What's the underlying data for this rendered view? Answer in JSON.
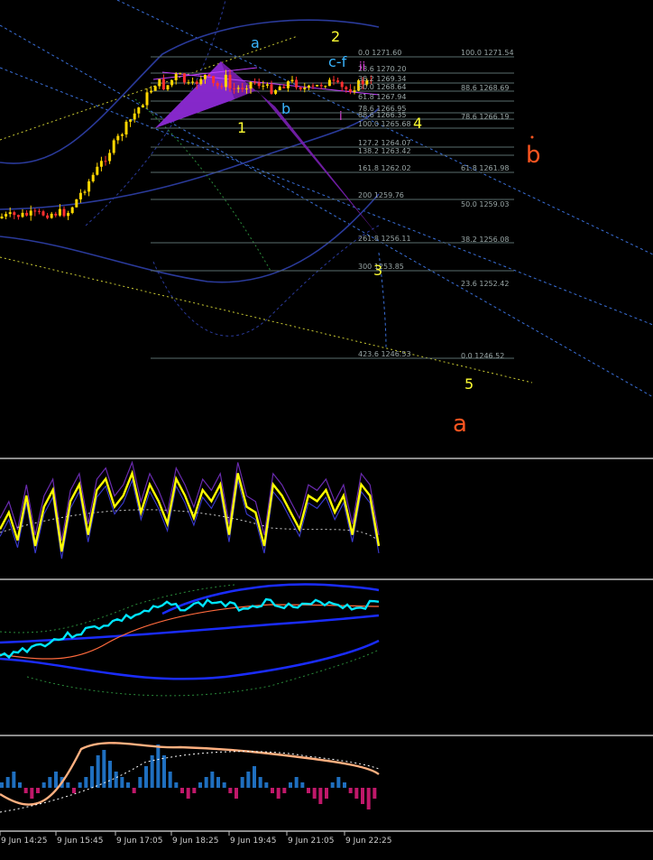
{
  "chart_data": [
    {
      "type": "candlestick",
      "panel": "main",
      "fib_left": [
        "0.0 1271.60",
        "23.6 1270.20",
        "38.2 1269.34",
        "50.0 1268.64",
        "61.8 1267.94",
        "78.6 1266.95",
        "88.6 1266.35",
        "100.0 1265.68",
        "127.2 1264.07",
        "138.2 1263.42",
        "161.8 1262.02",
        "200 1259.76",
        "261.8 1256.11",
        "300 1253.85",
        "423.6 1246.53"
      ],
      "fib_right": [
        "100.0 1271.54",
        "88.6 1268.69",
        "78.6 1266.19",
        "61.8 1261.98",
        "50.0 1259.03",
        "38.2 1256.08",
        "23.6 1252.42",
        "0.0 1246.52"
      ],
      "wave_labels": {
        "yellow": [
          "1",
          "2",
          "3",
          "4",
          "5"
        ],
        "blue": [
          "a",
          "b",
          "c-f"
        ],
        "magenta": [
          "i",
          "ii"
        ],
        "red": [
          "b",
          "a"
        ]
      },
      "colors": {
        "bull_candle": "#ffd700",
        "bear_candle": "#ff3030",
        "pattern_fill": "#7a1fb3",
        "channel": "#3a6fd8",
        "band": "#2a3a9a"
      }
    },
    {
      "type": "line",
      "panel": "oscillator",
      "series": [
        {
          "values": [
            40,
            55,
            30,
            70,
            25,
            60,
            75,
            20,
            65,
            80,
            35,
            75,
            85,
            60,
            70,
            90,
            55,
            80,
            65,
            45,
            85,
            70,
            50,
            75,
            65,
            80,
            35,
            90,
            60,
            55,
            25,
            80,
            70,
            55,
            40,
            70,
            65,
            75,
            55,
            70,
            35,
            80,
            70,
            25
          ],
          "color": "#ffff00"
        }
      ]
    },
    {
      "type": "line",
      "panel": "indicator",
      "series": [
        {
          "color": "#00e5ff"
        },
        {
          "color": "#1a2cff"
        },
        {
          "color": "#ff6a3d"
        }
      ]
    },
    {
      "type": "bar",
      "panel": "histogram",
      "values": [
        1,
        2,
        3,
        1,
        -1,
        -2,
        -1,
        1,
        2,
        3,
        2,
        1,
        -1,
        1,
        2,
        4,
        6,
        7,
        5,
        3,
        2,
        1,
        -1,
        2,
        4,
        6,
        8,
        6,
        3,
        1,
        -1,
        -2,
        -1,
        1,
        2,
        3,
        2,
        1,
        -1,
        -2,
        2,
        3,
        4,
        2,
        1,
        -1,
        -2,
        -1,
        1,
        2,
        1,
        -1,
        -2,
        -3,
        -2,
        1,
        2,
        1,
        -1,
        -2,
        -3,
        -4,
        -2
      ],
      "colors": {
        "positive": "#1f6fbf",
        "negative": "#c0186a",
        "line_main": "#ffb080",
        "line_signal": "#ffffff"
      }
    }
  ],
  "time_axis": [
    "9 Jun 14:25",
    "9 Jun 15:45",
    "9 Jun 17:05",
    "9 Jun 18:25",
    "9 Jun 19:45",
    "9 Jun 21:05",
    "9 Jun 22:25"
  ]
}
